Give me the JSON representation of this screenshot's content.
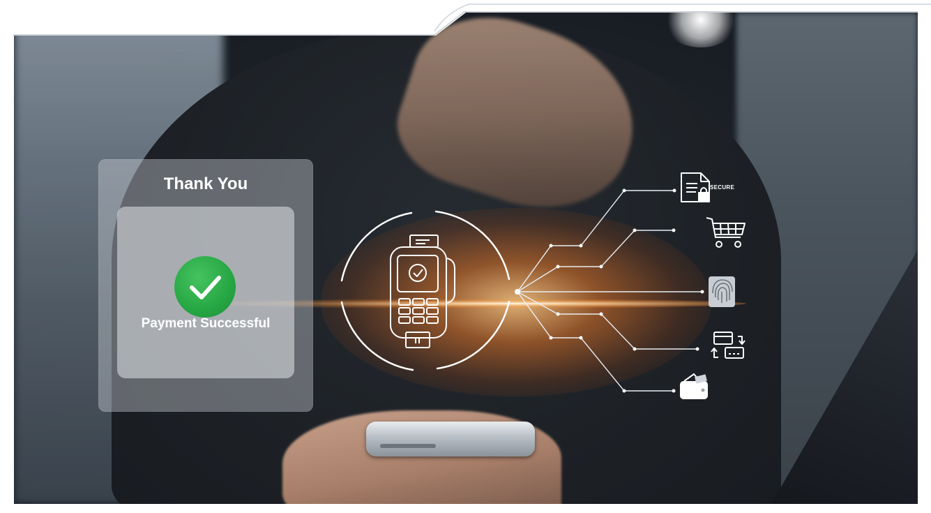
{
  "card": {
    "title": "Thank You",
    "status": "Payment Successful",
    "status_icon": "checkmark-circle-icon",
    "accent_color": "#2aa84a"
  },
  "terminal": {
    "icon": "payment-terminal-icon"
  },
  "features": [
    {
      "icon": "secure-document-icon",
      "label": "SECURE"
    },
    {
      "icon": "shopping-cart-icon"
    },
    {
      "icon": "fingerprint-icon"
    },
    {
      "icon": "card-transfer-icon"
    },
    {
      "icon": "wallet-icon"
    }
  ],
  "colors": {
    "glow": "#f0a050",
    "icon": "#ffffff"
  }
}
